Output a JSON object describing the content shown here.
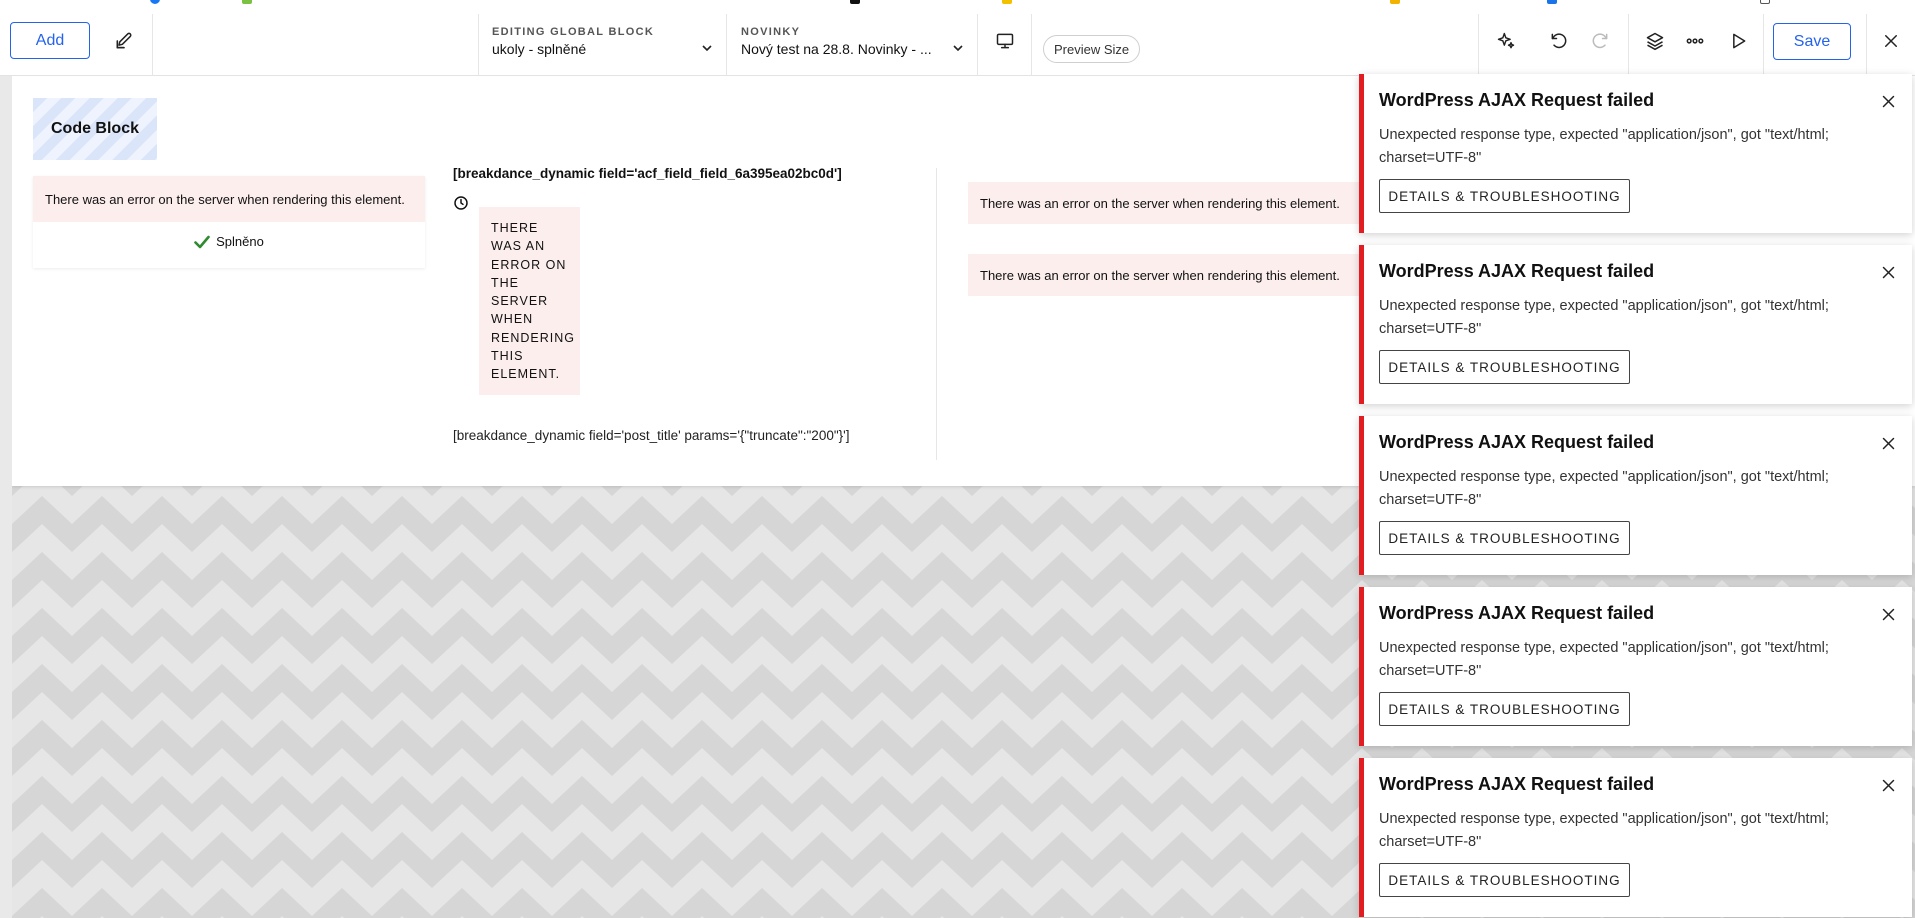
{
  "toolbar": {
    "add_label": "Add",
    "editing": {
      "label": "EDITING GLOBAL BLOCK",
      "value": "ukoly - splněné"
    },
    "post": {
      "label": "NOVINKY",
      "value": "Nový test na 28.8. Novinky - ..."
    },
    "preview_size_label": "Preview Size",
    "save_label": "Save"
  },
  "canvas": {
    "code_block_label": "Code Block",
    "error_text": "There was an error on the server when rendering this element.",
    "status_label": "Splněno",
    "dynamic_field_title": "[breakdance_dynamic field='acf_field_field_6a395ea02bc0d']",
    "error_vertical": "THERE WAS AN ERROR ON THE SERVER WHEN RENDERING THIS ELEMENT.",
    "dynamic_post_title": "[breakdance_dynamic field='post_title' params='{\"truncate\":\"200\"}']"
  },
  "notifications": [
    {
      "title": "WordPress AJAX Request failed",
      "message": "Unexpected response type, expected \"application/json\", got \"text/html; charset=UTF-8\"",
      "button": "DETAILS & TROUBLESHOOTING"
    },
    {
      "title": "WordPress AJAX Request failed",
      "message": "Unexpected response type, expected \"application/json\", got \"text/html; charset=UTF-8\"",
      "button": "DETAILS & TROUBLESHOOTING"
    },
    {
      "title": "WordPress AJAX Request failed",
      "message": "Unexpected response type, expected \"application/json\", got \"text/html; charset=UTF-8\"",
      "button": "DETAILS & TROUBLESHOOTING"
    },
    {
      "title": "WordPress AJAX Request failed",
      "message": "Unexpected response type, expected \"application/json\", got \"text/html; charset=UTF-8\"",
      "button": "DETAILS & TROUBLESHOOTING"
    },
    {
      "title": "WordPress AJAX Request failed",
      "message": "Unexpected response type, expected \"application/json\", got \"text/html; charset=UTF-8\"",
      "button": "DETAILS & TROUBLESHOOTING"
    }
  ],
  "colors": {
    "accent": "#2563eb",
    "error_bg": "#fdeeee",
    "notification_border": "#e11d21",
    "success": "#2e8b2e"
  },
  "icons": {
    "toolbar": [
      "edit-icon",
      "desktop-icon",
      "chevron-down-icon",
      "ai-sparkle-icon",
      "undo-icon",
      "redo-icon",
      "layers-icon",
      "more-icon",
      "play-icon",
      "close-icon"
    ],
    "canvas": [
      "clock-icon",
      "checkmark-icon"
    ]
  }
}
